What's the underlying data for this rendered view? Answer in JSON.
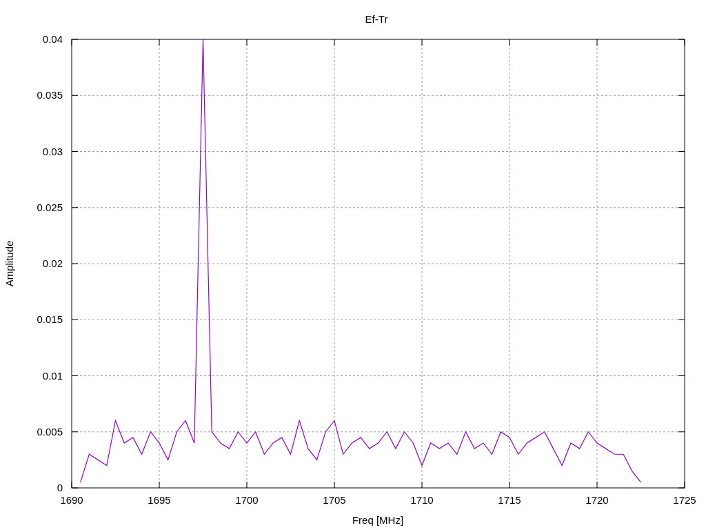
{
  "chart": {
    "chart_data": {
      "type": "line",
      "grid": true,
      "title": "Ef-Tr",
      "xlabel": "Freq [MHz]",
      "ylabel": "Amplitude",
      "x": [
        1690.5,
        1691,
        1691.5,
        1692,
        1692.5,
        1693,
        1693.5,
        1694,
        1694.5,
        1695,
        1695.5,
        1696,
        1696.5,
        1697,
        1697.5,
        1698,
        1698.5,
        1699,
        1699.5,
        1700,
        1700.5,
        1701,
        1701.5,
        1702,
        1702.5,
        1703,
        1703.5,
        1704,
        1704.5,
        1705,
        1705.5,
        1706,
        1706.5,
        1707,
        1707.5,
        1708,
        1708.5,
        1709,
        1709.5,
        1710,
        1710.5,
        1711,
        1711.5,
        1712,
        1712.5,
        1713,
        1713.5,
        1714,
        1714.5,
        1715,
        1715.5,
        1716,
        1716.5,
        1717,
        1717.5,
        1718,
        1718.5,
        1719,
        1719.5,
        1720,
        1720.5,
        1721,
        1721.5,
        1722,
        1722.5
      ],
      "series": [
        {
          "color": "#9400d3",
          "values": [
            0.0005,
            0.003,
            0.0025,
            0.002,
            0.006,
            0.004,
            0.0045,
            0.003,
            0.005,
            0.004,
            0.0025,
            0.005,
            0.006,
            0.004,
            0.04,
            0.005,
            0.004,
            0.0035,
            0.005,
            0.004,
            0.005,
            0.003,
            0.004,
            0.0045,
            0.003,
            0.006,
            0.0035,
            0.0025,
            0.005,
            0.006,
            0.003,
            0.004,
            0.0045,
            0.0035,
            0.004,
            0.005,
            0.0035,
            0.005,
            0.004,
            0.002,
            0.004,
            0.0035,
            0.004,
            0.003,
            0.005,
            0.0035,
            0.004,
            0.003,
            0.005,
            0.0045,
            0.003,
            0.004,
            0.0045,
            0.005,
            0.0035,
            0.002,
            0.004,
            0.0035,
            0.005,
            0.004,
            0.0035,
            0.003,
            0.003,
            0.0015,
            0.0005
          ]
        }
      ],
      "xlim": [
        1690,
        1725
      ],
      "ylim": [
        0,
        0.04
      ],
      "xticks": [
        1690,
        1695,
        1700,
        1705,
        1710,
        1715,
        1720,
        1725
      ],
      "yticks": [
        {
          "value": 0,
          "label": "0"
        },
        {
          "value": 0.005,
          "label": "0.005"
        },
        {
          "value": 0.01,
          "label": "0.01"
        },
        {
          "value": 0.015,
          "label": "0.015"
        },
        {
          "value": 0.02,
          "label": "0.02"
        },
        {
          "value": 0.025,
          "label": "0.025"
        },
        {
          "value": 0.03,
          "label": "0.03"
        },
        {
          "value": 0.035,
          "label": "0.035"
        },
        {
          "value": 0.04,
          "label": "0.04"
        }
      ]
    }
  }
}
